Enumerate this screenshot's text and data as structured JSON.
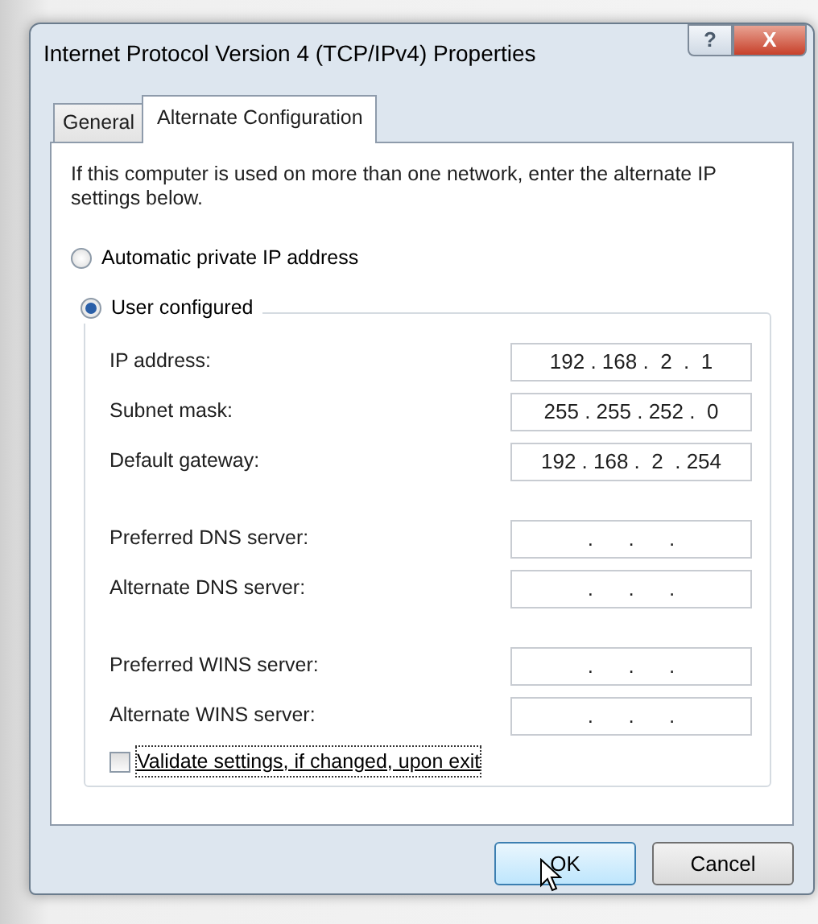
{
  "window": {
    "title": "Internet Protocol Version 4 (TCP/IPv4) Properties",
    "buttons": [
      {
        "kind": "help",
        "label": "?"
      },
      {
        "kind": "close",
        "label": "X"
      }
    ]
  },
  "tabs": [
    {
      "label": "General",
      "selected": false
    },
    {
      "label": "Alternate Configuration",
      "selected": true
    }
  ],
  "intro": "If this computer is used on more than one network, enter the alternate IP settings below.",
  "radios": [
    {
      "label": "Automatic private IP address",
      "selected": false
    },
    {
      "label": "User configured",
      "selected": true
    }
  ],
  "field_groups": [
    [
      {
        "label": "IP address:",
        "value": "192 . 168 .  2  .  1"
      },
      {
        "label": "Subnet mask:",
        "value": "255 . 255 . 252 .  0"
      },
      {
        "label": "Default gateway:",
        "value": "192 . 168 .  2  . 254"
      }
    ],
    [
      {
        "label": "Preferred DNS server:",
        "value": ".      .      ."
      },
      {
        "label": "Alternate DNS server:",
        "value": ".      .      ."
      }
    ],
    [
      {
        "label": "Preferred WINS server:",
        "value": ".      .      ."
      },
      {
        "label": "Alternate WINS server:",
        "value": ".      .      ."
      }
    ]
  ],
  "checkbox": {
    "label": "Validate settings, if changed, upon exit",
    "checked": false,
    "focused": true
  },
  "buttons": [
    {
      "label": "OK",
      "highlighted": true
    },
    {
      "label": "Cancel",
      "highlighted": false
    }
  ]
}
